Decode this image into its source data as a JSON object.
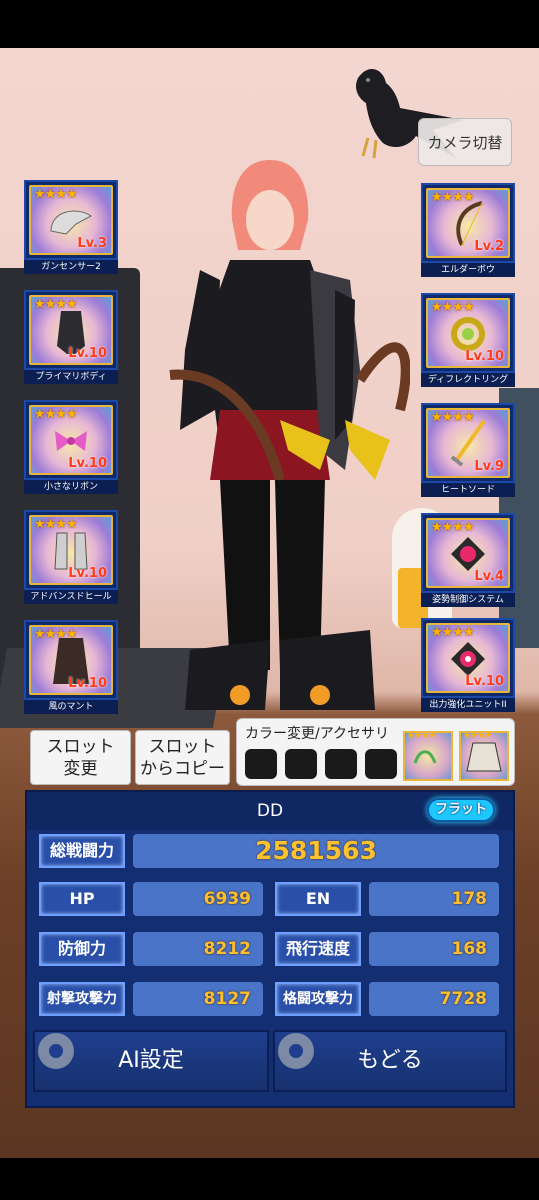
{
  "camera_button": "カメラ切替",
  "left_slots": [
    {
      "name": "ガンセンサー2",
      "stars": "★★★★",
      "level": "Lv.3"
    },
    {
      "name": "プライマリボディ",
      "stars": "★★★★",
      "level": "Lv.10"
    },
    {
      "name": "小さなリボン",
      "stars": "★★★★",
      "level": "Lv.10"
    },
    {
      "name": "アドバンスドヒール",
      "stars": "★★★★",
      "level": "Lv.10"
    },
    {
      "name": "風のマント",
      "stars": "★★★★",
      "level": "Lv.10"
    }
  ],
  "right_slots": [
    {
      "name": "エルダーボウ",
      "stars": "★★★★",
      "level": "Lv.2"
    },
    {
      "name": "ディフレクトリング",
      "stars": "★★★★",
      "level": "Lv.10"
    },
    {
      "name": "ヒートソード",
      "stars": "★★★★",
      "level": "Lv.9"
    },
    {
      "name": "姿勢制御システム",
      "stars": "★★★★",
      "level": "Lv.4"
    },
    {
      "name": "出力強化ユニットII",
      "stars": "★★★★",
      "level": "Lv.10"
    }
  ],
  "slot_change_line1": "スロット",
  "slot_change_line2": "変更",
  "slot_copy_line1": "スロット",
  "slot_copy_line2": "からコピー",
  "color_panel_title": "カラー変更/アクセサリ",
  "accessory_stars": "★★★★",
  "character_name": "DD",
  "flat_badge": "フラット",
  "stats": {
    "total_label": "総戦闘力",
    "total_value": "2581563",
    "hp_label": "HP",
    "hp_value": "6939",
    "en_label": "EN",
    "en_value": "178",
    "defense_label": "防御力",
    "defense_value": "8212",
    "flight_label": "飛行速度",
    "flight_value": "168",
    "ranged_label": "射撃攻撃力",
    "ranged_value": "8127",
    "melee_label": "格闘攻撃力",
    "melee_value": "7728"
  },
  "ai_button": "AI設定",
  "back_button": "もどる",
  "colors": {
    "panel": "#142e72",
    "value": "#ffbe2e",
    "badge": "#1ec8ff"
  }
}
